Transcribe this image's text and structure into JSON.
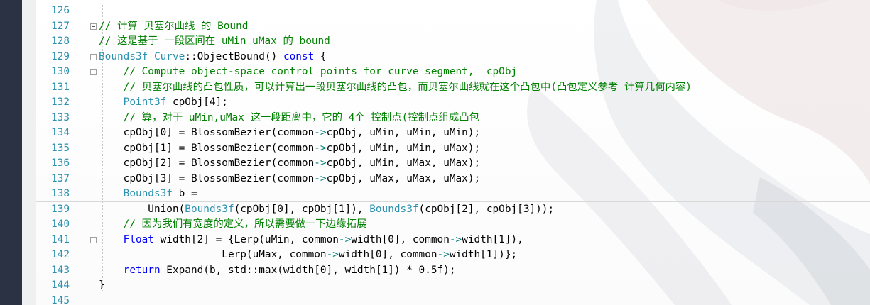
{
  "editor": {
    "lines": [
      {
        "no": "126",
        "fold": false,
        "segs": []
      },
      {
        "no": "127",
        "fold": true,
        "segs": [
          {
            "cls": "c",
            "text": "// 计算 贝塞尔曲线 的 Bound"
          }
        ]
      },
      {
        "no": "128",
        "fold": false,
        "segs": [
          {
            "cls": "c",
            "text": "// 这是基于 一段区间在 uMin uMax 的 bound"
          }
        ]
      },
      {
        "no": "129",
        "fold": true,
        "segs": [
          {
            "cls": "t",
            "text": "Bounds3f"
          },
          {
            "cls": "p",
            "text": " "
          },
          {
            "cls": "t",
            "text": "Curve"
          },
          {
            "cls": "p",
            "text": "::ObjectBound() "
          },
          {
            "cls": "k",
            "text": "const"
          },
          {
            "cls": "p",
            "text": " {"
          }
        ]
      },
      {
        "no": "130",
        "fold": true,
        "segs": [
          {
            "cls": "c",
            "text": "    // Compute object-space control points for curve segment, _cpObj_"
          }
        ]
      },
      {
        "no": "131",
        "fold": false,
        "segs": [
          {
            "cls": "c",
            "text": "    // 贝塞尔曲线的凸包性质，可以计算出一段贝塞尔曲线的凸包，而贝塞尔曲线就在这个凸包中(凸包定义参考 计算几何内容)"
          }
        ]
      },
      {
        "no": "132",
        "fold": false,
        "segs": [
          {
            "cls": "t",
            "text": "    Point3f"
          },
          {
            "cls": "p",
            "text": " cpObj[4];"
          }
        ]
      },
      {
        "no": "133",
        "fold": false,
        "segs": [
          {
            "cls": "c",
            "text": "    // 算，对于 uMin,uMax 这一段距离中，它的 4个 控制点(控制点组成凸包"
          }
        ]
      },
      {
        "no": "134",
        "fold": false,
        "segs": [
          {
            "cls": "p",
            "text": "    cpObj[0] = BlossomBezier(common"
          },
          {
            "cls": "g",
            "text": "->"
          },
          {
            "cls": "p",
            "text": "cpObj, uMin, uMin, uMin);"
          }
        ]
      },
      {
        "no": "135",
        "fold": false,
        "segs": [
          {
            "cls": "p",
            "text": "    cpObj[1] = BlossomBezier(common"
          },
          {
            "cls": "g",
            "text": "->"
          },
          {
            "cls": "p",
            "text": "cpObj, uMin, uMin, uMax);"
          }
        ]
      },
      {
        "no": "136",
        "fold": false,
        "segs": [
          {
            "cls": "p",
            "text": "    cpObj[2] = BlossomBezier(common"
          },
          {
            "cls": "g",
            "text": "->"
          },
          {
            "cls": "p",
            "text": "cpObj, uMin, uMax, uMax);"
          }
        ]
      },
      {
        "no": "137",
        "fold": false,
        "segs": [
          {
            "cls": "p",
            "text": "    cpObj[3] = BlossomBezier(common"
          },
          {
            "cls": "g",
            "text": "->"
          },
          {
            "cls": "p",
            "text": "cpObj, uMax, uMax, uMax);"
          }
        ]
      },
      {
        "no": "138",
        "fold": false,
        "current": true,
        "segs": [
          {
            "cls": "t",
            "text": "    Bounds3f"
          },
          {
            "cls": "p",
            "text": " b ="
          }
        ]
      },
      {
        "no": "139",
        "fold": false,
        "segs": [
          {
            "cls": "p",
            "text": "        Union("
          },
          {
            "cls": "t",
            "text": "Bounds3f"
          },
          {
            "cls": "p",
            "text": "(cpObj[0], cpObj[1]), "
          },
          {
            "cls": "t",
            "text": "Bounds3f"
          },
          {
            "cls": "p",
            "text": "(cpObj[2], cpObj[3]));"
          }
        ]
      },
      {
        "no": "140",
        "fold": false,
        "segs": [
          {
            "cls": "c",
            "text": "    // 因为我们有宽度的定义，所以需要做一下边缘拓展"
          }
        ]
      },
      {
        "no": "141",
        "fold": true,
        "segs": [
          {
            "cls": "k",
            "text": "    Float"
          },
          {
            "cls": "p",
            "text": " width[2] = {Lerp(uMin, common"
          },
          {
            "cls": "g",
            "text": "->"
          },
          {
            "cls": "p",
            "text": "width[0], common"
          },
          {
            "cls": "g",
            "text": "->"
          },
          {
            "cls": "p",
            "text": "width[1]),"
          }
        ]
      },
      {
        "no": "142",
        "fold": false,
        "segs": [
          {
            "cls": "p",
            "text": "                    Lerp(uMax, common"
          },
          {
            "cls": "g",
            "text": "->"
          },
          {
            "cls": "p",
            "text": "width[0], common"
          },
          {
            "cls": "g",
            "text": "->"
          },
          {
            "cls": "p",
            "text": "width[1])};"
          }
        ]
      },
      {
        "no": "143",
        "fold": false,
        "segs": [
          {
            "cls": "k",
            "text": "    return"
          },
          {
            "cls": "p",
            "text": " Expand(b, std::max(width[0], width[1]) * 0.5f);"
          }
        ]
      },
      {
        "no": "144",
        "fold": false,
        "segs": [
          {
            "cls": "p",
            "text": "}"
          }
        ]
      },
      {
        "no": "145",
        "fold": false,
        "segs": []
      }
    ]
  }
}
